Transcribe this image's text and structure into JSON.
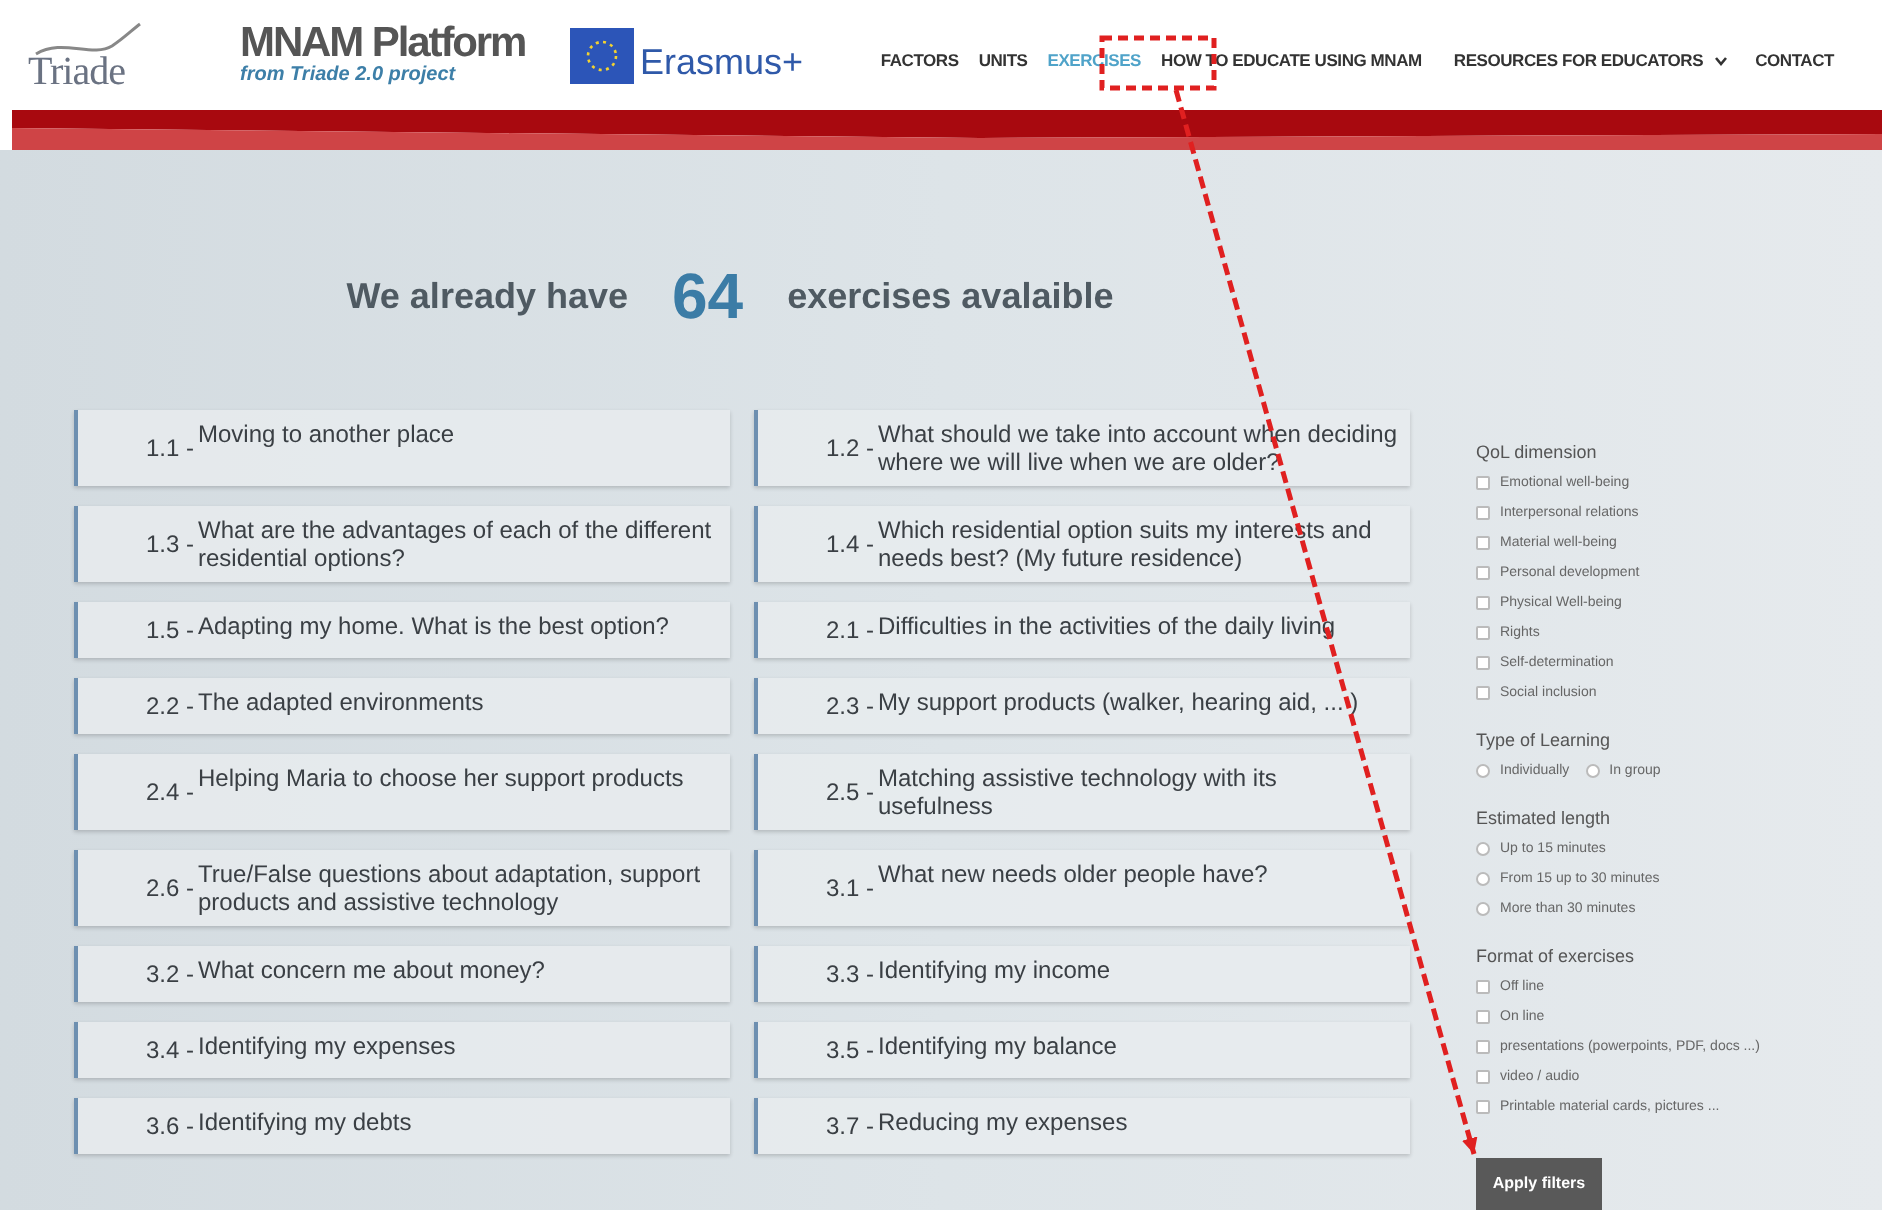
{
  "brand": {
    "partner": "Triade",
    "title": "MNAM Platform",
    "subtitle": "from Triade 2.0 project",
    "program": "Erasmus+"
  },
  "nav": [
    {
      "label": "FACTORS",
      "selected": false
    },
    {
      "label": "UNITS",
      "selected": false
    },
    {
      "label": "EXERCISES",
      "selected": true
    },
    {
      "label": "HOW TO EDUCATE USING MNAM",
      "selected": false
    },
    {
      "label": "RESOURCES FOR EDUCATORS",
      "selected": false,
      "dropdown": true
    },
    {
      "label": "CONTACT",
      "selected": false
    }
  ],
  "headline": {
    "before": "We already have",
    "count": "64",
    "after": "exercises avalaible"
  },
  "exercises": [
    {
      "number": "1.1 -",
      "title": "Moving to another place"
    },
    {
      "number": "1.2 -",
      "title": "What should we take into account when deciding where we will live when we are older?"
    },
    {
      "number": "1.3 -",
      "title": "What are the advantages of each of the different residential options?"
    },
    {
      "number": "1.4 -",
      "title": "Which residential option suits my interests and needs best? (My future residence)"
    },
    {
      "number": "1.5 -",
      "title": "Adapting my home. What is the best option?"
    },
    {
      "number": "2.1 -",
      "title": "Difficulties in the activities of the daily living"
    },
    {
      "number": "2.2 -",
      "title": "The adapted environments"
    },
    {
      "number": "2.3 -",
      "title": "My support products (walker, hearing aid, ... )"
    },
    {
      "number": "2.4 -",
      "title": "Helping Maria to choose her support products"
    },
    {
      "number": "2.5 -",
      "title": "Matching assistive technology with its usefulness"
    },
    {
      "number": "2.6 -",
      "title": "True/False questions about adaptation, support products and assistive technology"
    },
    {
      "number": "3.1 -",
      "title": "What new needs older people have?"
    },
    {
      "number": "3.2 -",
      "title": "What concern me about money?"
    },
    {
      "number": "3.3 -",
      "title": "Identifying my income"
    },
    {
      "number": "3.4 -",
      "title": "Identifying my expenses"
    },
    {
      "number": "3.5 -",
      "title": "Identifying my balance"
    },
    {
      "number": "3.6 -",
      "title": "Identifying my debts"
    },
    {
      "number": "3.7 -",
      "title": "Reducing my expenses"
    }
  ],
  "filters": [
    {
      "title": "QoL dimension",
      "inline": false,
      "options": [
        {
          "label": "Emotional well-being",
          "kind": "checkbox",
          "checked": false
        },
        {
          "label": "Interpersonal relations",
          "kind": "checkbox",
          "checked": false
        },
        {
          "label": "Material well-being",
          "kind": "checkbox",
          "checked": false
        },
        {
          "label": "Personal development",
          "kind": "checkbox",
          "checked": false
        },
        {
          "label": "Physical Well-being",
          "kind": "checkbox",
          "checked": false
        },
        {
          "label": "Rights",
          "kind": "checkbox",
          "checked": false
        },
        {
          "label": "Self-determination",
          "kind": "checkbox",
          "checked": false
        },
        {
          "label": "Social inclusion",
          "kind": "checkbox",
          "checked": false
        }
      ]
    },
    {
      "title": "Type of Learning",
      "inline": true,
      "options": [
        {
          "label": "Individually",
          "kind": "radio",
          "checked": false
        },
        {
          "label": "In group",
          "kind": "radio",
          "checked": false
        }
      ]
    },
    {
      "title": "Estimated length",
      "inline": false,
      "options": [
        {
          "label": "Up to 15 minutes",
          "kind": "radio",
          "checked": false
        },
        {
          "label": "From 15 up to 30 minutes",
          "kind": "radio",
          "checked": false
        },
        {
          "label": "More than 30 minutes",
          "kind": "radio",
          "checked": false
        }
      ]
    },
    {
      "title": "Format of exercises",
      "inline": false,
      "options": [
        {
          "label": "Off line",
          "kind": "checkbox",
          "checked": false
        },
        {
          "label": "On line",
          "kind": "checkbox",
          "checked": false
        },
        {
          "label": "presentations (powerpoints, PDF, docs ...)",
          "kind": "checkbox",
          "checked": false
        },
        {
          "label": "video / audio",
          "kind": "checkbox",
          "checked": false
        },
        {
          "label": "Printable material cards, pictures ...",
          "kind": "checkbox",
          "checked": false
        }
      ]
    }
  ],
  "apply_button": "Apply filters"
}
